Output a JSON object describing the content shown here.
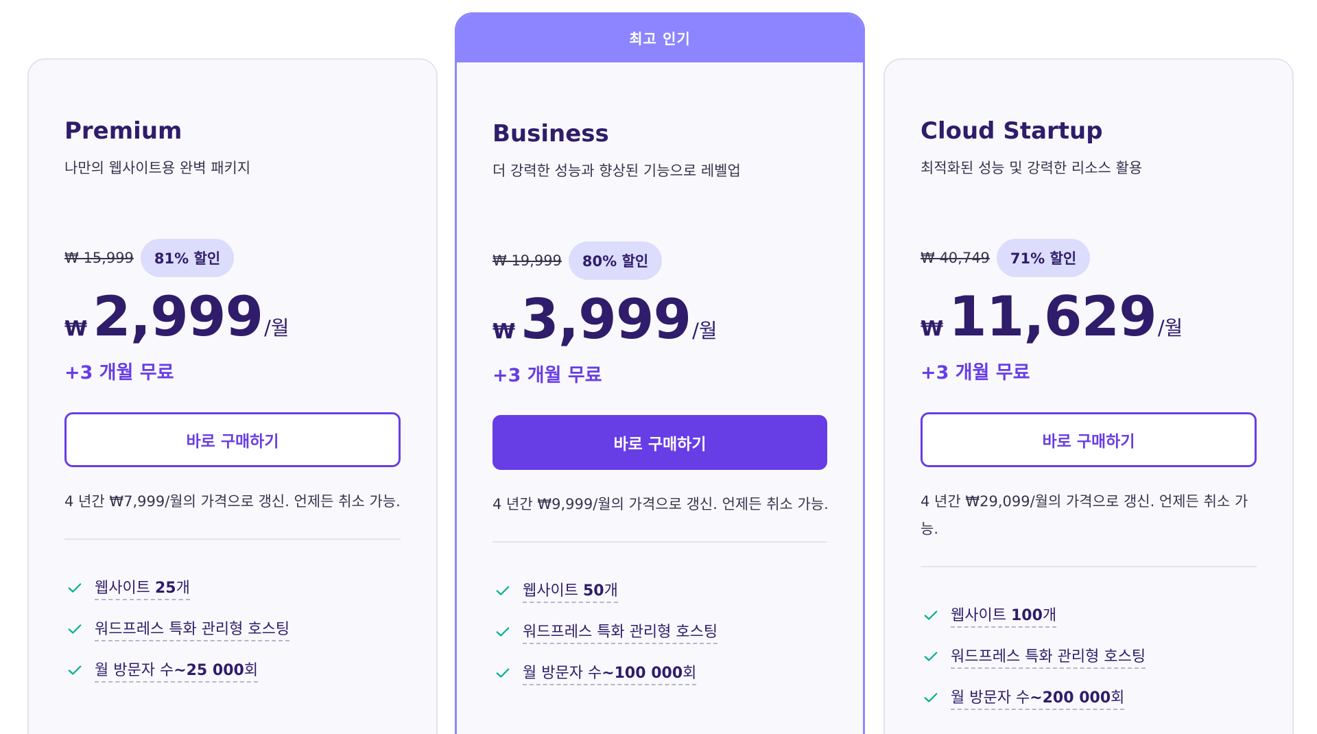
{
  "plans": [
    {
      "name": "Premium",
      "description": "나만의 웹사이트용 완벽 패키지",
      "old_price": "₩ 15,999",
      "discount": "81% 할인",
      "currency": "₩",
      "price": "2,999",
      "per": "/월",
      "bonus": "+3 개월 무료",
      "button": "바로 구매하기",
      "renewal": "4 년간 ₩7,999/월의 가격으로 갱신. 언제든 취소 가능.",
      "features": [
        {
          "prefix": "웹사이트 ",
          "value": "25",
          "suffix": "개"
        },
        {
          "prefix": "워드프레스 특화 관리형 호스팅",
          "value": "",
          "suffix": ""
        },
        {
          "prefix": "월 방문자 수",
          "value": "~25 000",
          "suffix": "회"
        }
      ]
    },
    {
      "badge": "최고 인기",
      "name": "Business",
      "description": "더 강력한 성능과 향상된 기능으로 레벨업",
      "old_price": "₩ 19,999",
      "discount": "80% 할인",
      "currency": "₩",
      "price": "3,999",
      "per": "/월",
      "bonus": "+3 개월 무료",
      "button": "바로 구매하기",
      "renewal": "4 년간 ₩9,999/월의 가격으로 갱신. 언제든 취소 가능.",
      "features": [
        {
          "prefix": "웹사이트 ",
          "value": "50",
          "suffix": "개"
        },
        {
          "prefix": "워드프레스 특화 관리형 호스팅",
          "value": "",
          "suffix": ""
        },
        {
          "prefix": "월 방문자 수",
          "value": "~100 000",
          "suffix": "회"
        }
      ]
    },
    {
      "name": "Cloud Startup",
      "description": "최적화된 성능 및 강력한 리소스 활용",
      "old_price": "₩ 40,749",
      "discount": "71% 할인",
      "currency": "₩",
      "price": "11,629",
      "per": "/월",
      "bonus": "+3 개월 무료",
      "button": "바로 구매하기",
      "renewal": "4 년간 ₩29,099/월의 가격으로 갱신. 언제든 취소 가능.",
      "features": [
        {
          "prefix": "웹사이트 ",
          "value": "100",
          "suffix": "개"
        },
        {
          "prefix": "워드프레스 특화 관리형 호스팅",
          "value": "",
          "suffix": ""
        },
        {
          "prefix": "월 방문자 수",
          "value": "~200 000",
          "suffix": "회"
        }
      ]
    }
  ],
  "colors": {
    "accent": "#673de6",
    "badge_bg": "#8c85ff",
    "heading": "#2f1c6a",
    "check": "#00b090"
  },
  "icons": {
    "feature": "check-icon"
  }
}
